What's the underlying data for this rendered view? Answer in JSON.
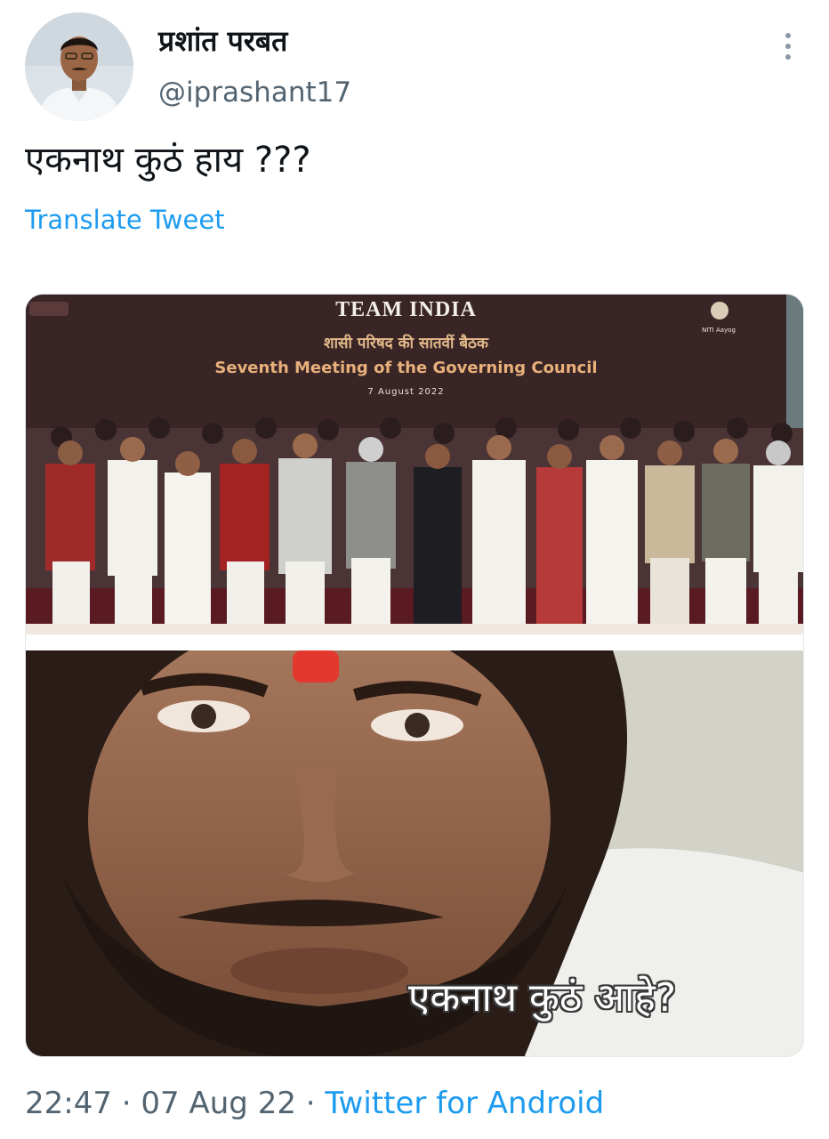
{
  "tweet": {
    "display_name": "प्रशांत परबत",
    "handle": "@iprashant17",
    "text": "एकनाथ कुठं हाय ???",
    "translate_label": "Translate Tweet",
    "menu_icon": "more-vertical-icon"
  },
  "media": {
    "top_image": {
      "banner_title": "TEAM INDIA",
      "banner_subtitle_hindi": "शासी परिषद की सातवीं बैठक",
      "banner_subtitle_english": "Seventh Meeting of the Governing Council",
      "banner_date": "7 August 2022",
      "logo_label": "NITI Aayog"
    },
    "bottom_image": {
      "caption": "एकनाथ कुठं आहे?"
    }
  },
  "meta": {
    "time": "22:47",
    "date": "07 Aug 22",
    "separator": "·",
    "source": "Twitter for Android"
  },
  "colors": {
    "link": "#1d9bf0",
    "secondary_text": "#536471",
    "primary_text": "#0f1419"
  }
}
